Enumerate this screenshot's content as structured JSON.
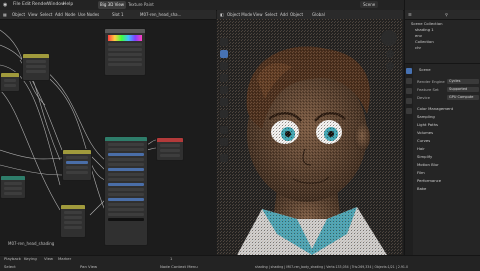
{
  "topbar": {
    "menus": [
      "File",
      "Edit",
      "Render",
      "Window",
      "Help"
    ],
    "tabs": [
      "Big 3D View",
      "Texture Paint"
    ],
    "scene": "Scene",
    "view_layer": "ViewLayer"
  },
  "node_editor": {
    "header_items": [
      "Object",
      "View",
      "Select",
      "Add",
      "Node",
      "Use Nodes",
      "Slot 1",
      "M07-ren_head_sha..."
    ],
    "material_label": "M07-ren_head_shading"
  },
  "viewport": {
    "header_items": [
      "Object Mode",
      "View",
      "Select",
      "Add",
      "Object",
      "Global"
    ]
  },
  "outliner": {
    "search_placeholder": "",
    "items": [
      "Scene Collection",
      "shading 1",
      "env",
      "Collection",
      "chr"
    ]
  },
  "properties": {
    "scene_title": "Scene",
    "render_engine_label": "Render Engine",
    "render_engine": "Cycles",
    "feature_set_label": "Feature Set",
    "feature_set": "Supported",
    "device_label": "Device",
    "device": "GPU Compute",
    "panels": [
      "Color Management",
      "Sampling",
      "Light Paths",
      "Volumes",
      "Curves",
      "Hair",
      "Simplify",
      "Motion Blur",
      "Film",
      "Performance",
      "Bake"
    ]
  },
  "status_bar": {
    "items": [
      "Playback",
      "Keying",
      "View",
      "Marker"
    ],
    "frame": "1",
    "select": "Select",
    "pan_view": "Pan View",
    "context_menu": "Node Context Menu",
    "info": "shading | shading | M07-ren_body_shading | Verts:133,054 | Tris:269,334 | Objects:1/21 | 2.91.0"
  },
  "colors": {
    "accent": "#4772b3",
    "node_header_yellow": "#a09a3c",
    "node_header_teal": "#2e7d6a",
    "node_header_red": "#b33a3a",
    "node_header_gray": "#5a5a5a"
  }
}
